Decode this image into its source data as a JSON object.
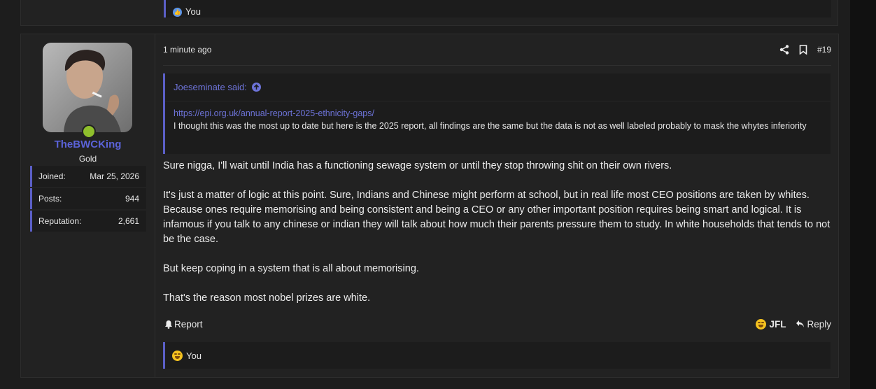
{
  "previous_post": {
    "reaction_label": "You"
  },
  "post": {
    "time": "1 minute ago",
    "post_number": "#19",
    "user": {
      "name": "TheBWCKing",
      "title": "Gold",
      "online": true,
      "stats": [
        {
          "label": "Joined:",
          "value": "Mar 25, 2026"
        },
        {
          "label": "Posts:",
          "value": "944"
        },
        {
          "label": "Reputation:",
          "value": "2,661"
        }
      ]
    },
    "quote": {
      "author_said": "Joeseminate said:",
      "link": "https://epi.org.uk/annual-report-2025-ethnicity-gaps/",
      "text": "I thought this was the most up to date but here is the 2025 report, all findings are the same but the data is not as well labeled probably to mask the whytes inferiority"
    },
    "message": [
      "Sure nigga, I'll wait until India has a functioning sewage system or until they stop throwing shit on their own rivers.",
      "It's just a matter of logic at this point. Sure, Indians and Chinese might perform at school, but in real life most CEO positions are taken by whites. Because ones require memorising and being consistent and being a CEO or any other important position requires being smart and logical. It is infamous if you talk to any chinese or indian they will talk about how much their parents pressure them to study. In white households that tends to not be the case.",
      "But keep coping in a system that is all about memorising.",
      "That's the reason most nobel prizes are white."
    ],
    "footer": {
      "report_label": "Report",
      "reaction_label": "JFL",
      "reply_label": "Reply"
    },
    "reactions_summary": "You"
  },
  "colors": {
    "accent": "#5b5fc7",
    "username": "#5b63d9",
    "online": "#8fbf2c"
  },
  "icons": [
    "like-icon",
    "share-icon",
    "bookmark-icon",
    "arrow-up-circle-icon",
    "bell-icon",
    "laughing-emoji-icon",
    "reply-icon"
  ]
}
